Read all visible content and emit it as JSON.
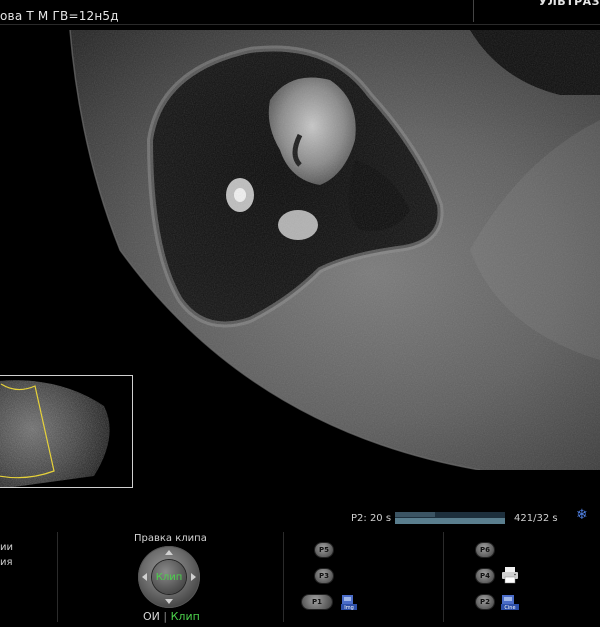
{
  "header": {
    "patient_info": "ова Т М  ГВ=12н5д",
    "brand": "УЛЬТРАЗ"
  },
  "clip_bar": {
    "label": "P2:  20 s",
    "frame_counter": "421/32 s",
    "settings_icon": "snowflake-icon",
    "progress_fraction": 0.36
  },
  "left_menu": {
    "line1": "ии",
    "line2": "ия"
  },
  "clip_editor": {
    "title": "Правка клипа",
    "center_label": "Клип",
    "mode_a": "ОИ",
    "mode_separator": "|",
    "mode_b": "Клип"
  },
  "presets": {
    "p1": "P1",
    "p2": "P2",
    "p3": "P3",
    "p4": "P4",
    "p5": "P5",
    "p6": "P6",
    "p1_icon": "save-image-icon",
    "p1_icon_label": "Img",
    "p4_icon": "printer-icon",
    "p2_icon": "save-cine-icon",
    "p2_icon_label": "Cine"
  },
  "colors": {
    "accent_green": "#4cd24c",
    "snowflake_blue": "#4f7fe0",
    "thumb_outline": "#e6d23a"
  }
}
